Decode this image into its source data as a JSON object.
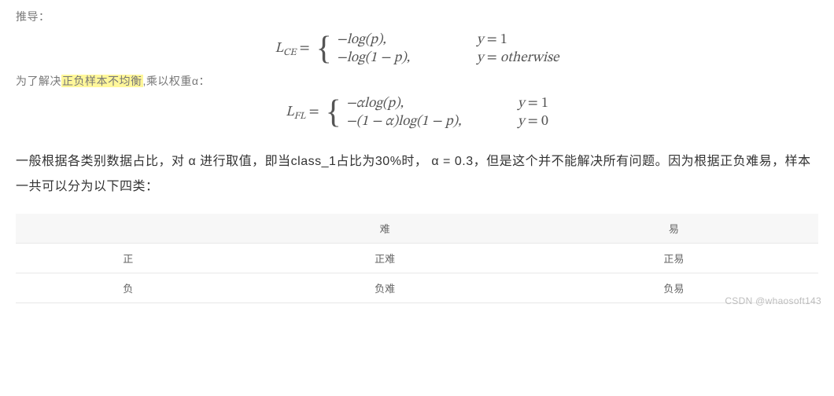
{
  "lead": "推导：",
  "formula_ce": {
    "lhs_base": "L",
    "lhs_sub": "CE",
    "eq": "=",
    "row1_expr": "−log(p),",
    "row1_cond_lhs": "y",
    "row1_cond_eq": "=",
    "row1_cond_rhs": "1",
    "row2_expr": "−log(1 − p),",
    "row2_cond_lhs": "y",
    "row2_cond_eq": "=",
    "row2_cond_rhs": "otherwise"
  },
  "mid_line_pre": "为了解决",
  "mid_line_hl": "正负样本不均衡",
  "mid_line_post": ",乘以权重α：",
  "formula_fl": {
    "lhs_base": "L",
    "lhs_sub": "FL",
    "eq": "=",
    "row1_expr": "−αlog(p),",
    "row1_cond_lhs": "y",
    "row1_cond_eq": "=",
    "row1_cond_rhs": "1",
    "row2_expr": "−(1 − α)log(1 − p),",
    "row2_cond_lhs": "y",
    "row2_cond_eq": "=",
    "row2_cond_rhs": "0"
  },
  "paragraph": "一般根据各类别数据占比，对 α 进行取值，即当class_1占比为30%时，  α = 0.3，但是这个并不能解决所有问题。因为根据正负难易，样本一共可以分为以下四类：",
  "table": {
    "headers": [
      "",
      "难",
      "易"
    ],
    "rows": [
      [
        "正",
        "正难",
        "正易"
      ],
      [
        "负",
        "负难",
        "负易"
      ]
    ]
  },
  "watermark": "CSDN @whaosoft143"
}
